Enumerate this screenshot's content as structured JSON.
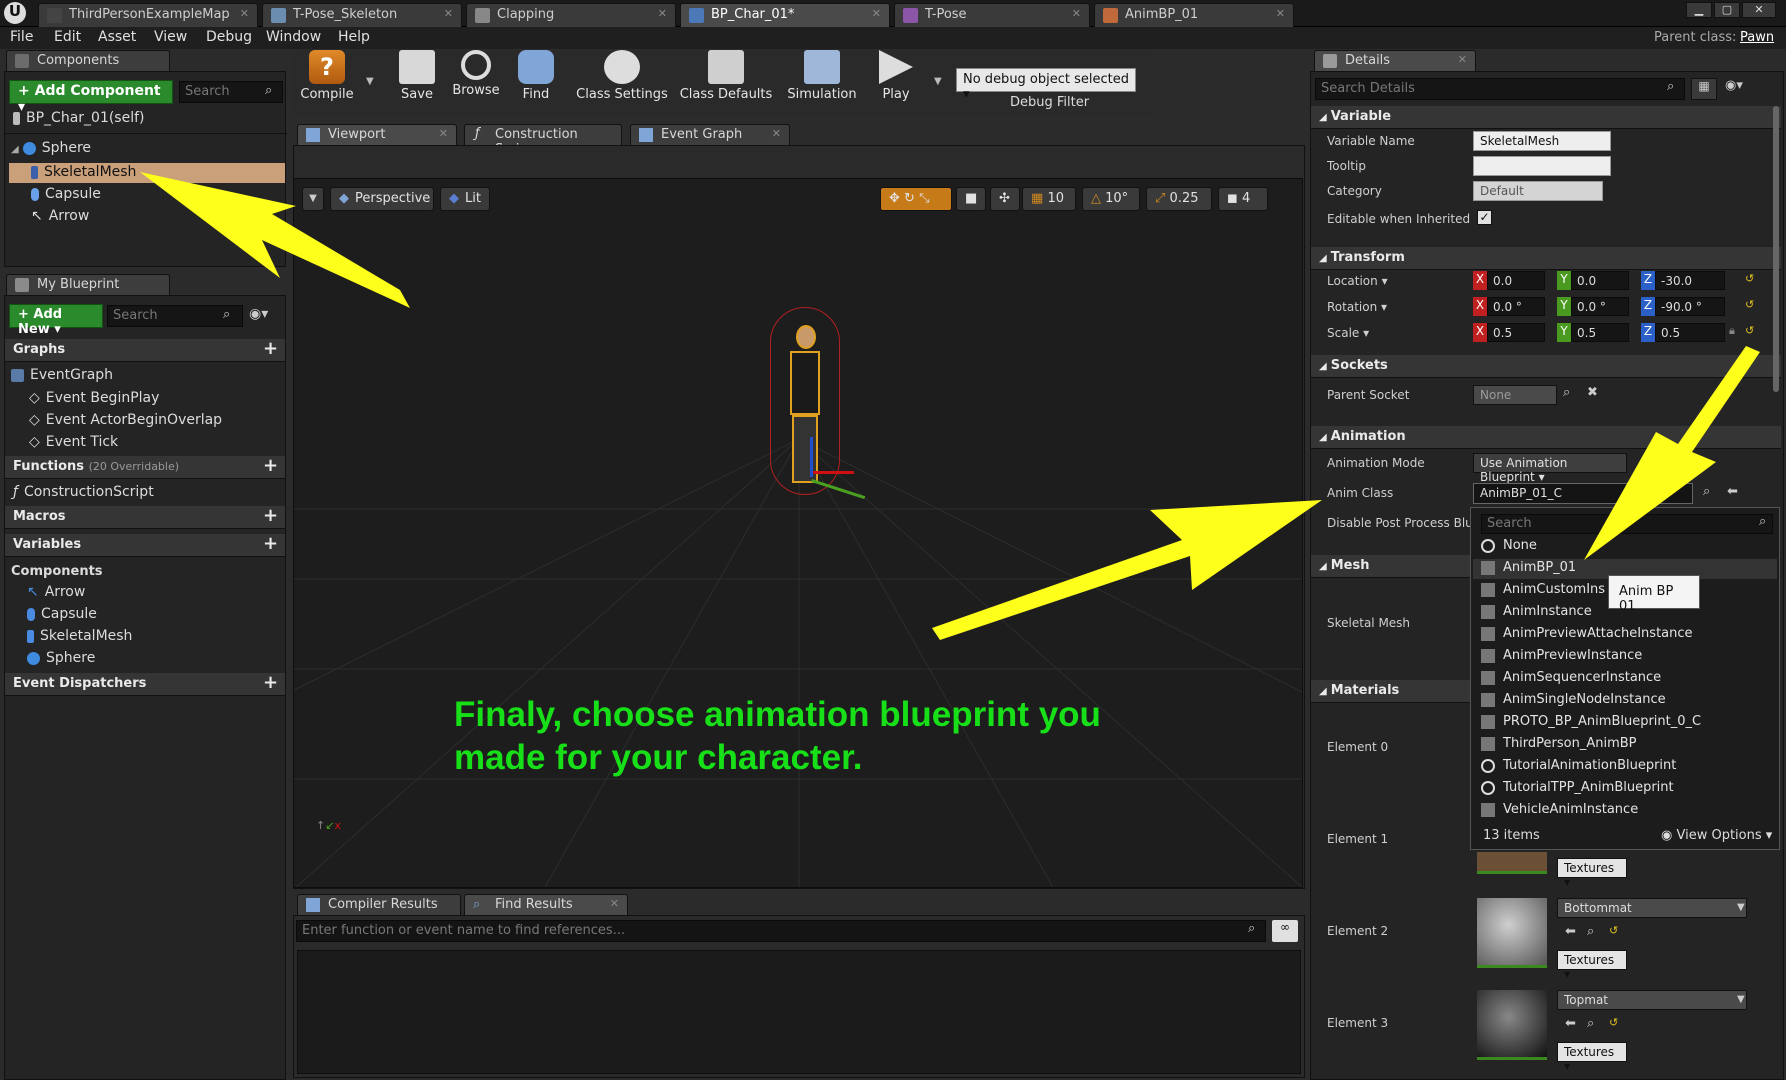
{
  "tabs": [
    "ThirdPersonExampleMap",
    "T-Pose_Skeleton",
    "Clapping",
    "BP_Char_01*",
    "T-Pose",
    "AnimBP_01"
  ],
  "menu": [
    "File",
    "Edit",
    "Asset",
    "View",
    "Debug",
    "Window",
    "Help"
  ],
  "parent_class_label": "Parent class:",
  "parent_class_value": "Pawn",
  "components_panel": {
    "tab": "Components",
    "add_button": "+ Add Component ▾",
    "search_placeholder": "Search",
    "self": "BP_Char_01(self)",
    "tree": [
      "Sphere",
      "SkeletalMesh",
      "Capsule",
      "Arrow"
    ]
  },
  "myblueprint_panel": {
    "tab": "My Blueprint",
    "add_button": "+ Add New ▾",
    "search_placeholder": "Search",
    "graphs_header": "Graphs",
    "event_graph": "EventGraph",
    "events": [
      "Event BeginPlay",
      "Event ActorBeginOverlap",
      "Event Tick"
    ],
    "functions_header": "Functions",
    "functions_count": "(20 Overridable)",
    "functions": [
      "ConstructionScript"
    ],
    "macros_header": "Macros",
    "variables_header": "Variables",
    "components_header": "Components",
    "var_components": [
      "Arrow",
      "Capsule",
      "SkeletalMesh",
      "Sphere"
    ],
    "dispatchers_header": "Event Dispatchers"
  },
  "toolbar": {
    "compile": "Compile",
    "save": "Save",
    "browse": "Browse",
    "find": "Find",
    "class_settings": "Class Settings",
    "class_defaults": "Class Defaults",
    "simulation": "Simulation",
    "play": "Play",
    "debug_select": "No debug object selected ▾",
    "debug_filter": "Debug Filter"
  },
  "editor_tabs": [
    "Viewport",
    "Construction Scrip",
    "Event Graph"
  ],
  "viewport": {
    "perspective": "Perspective",
    "lit": "Lit",
    "grid_snap": "10",
    "rot_snap": "10°",
    "scale_snap": "0.25",
    "cam_speed": "4",
    "annotation": "Finaly, choose animation blueprint you made for your character."
  },
  "bottom_tabs": [
    "Compiler Results",
    "Find Results"
  ],
  "find_placeholder": "Enter function or event name to find references...",
  "details": {
    "tab": "Details",
    "search_placeholder": "Search Details",
    "variable_header": "Variable",
    "variable_name_label": "Variable Name",
    "variable_name_value": "SkeletalMesh",
    "tooltip_label": "Tooltip",
    "category_label": "Category",
    "category_value": "Default",
    "editable_label": "Editable when Inherited",
    "transform_header": "Transform",
    "location_label": "Location ▾",
    "rotation_label": "Rotation ▾",
    "scale_label": "Scale ▾",
    "location": [
      "0.0",
      "0.0",
      "-30.0"
    ],
    "rotation": [
      "0.0 °",
      "0.0 °",
      "-90.0 °"
    ],
    "scale": [
      "0.5",
      "0.5",
      "0.5"
    ],
    "axis": [
      "X",
      "Y",
      "Z"
    ],
    "sockets_header": "Sockets",
    "parent_socket_label": "Parent Socket",
    "parent_socket_value": "None",
    "animation_header": "Animation",
    "anim_mode_label": "Animation Mode",
    "anim_mode_value": "Use Animation Blueprint ▾",
    "anim_class_label": "Anim Class",
    "anim_class_value": "AnimBP_01_C",
    "disable_pp_label": "Disable Post Process Blu",
    "mesh_header": "Mesh",
    "skeletal_mesh_label": "Skeletal Mesh",
    "materials_header": "Materials",
    "elements": [
      "Element 0",
      "Element 1",
      "Element 2",
      "Element 3"
    ],
    "element2_mat": "Bottommat",
    "element3_mat": "Topmat",
    "textures": "Textures ▾"
  },
  "anim_dropdown": {
    "search_placeholder": "Search",
    "items": [
      "None",
      "AnimBP_01",
      "AnimCustomIns",
      "AnimInstance",
      "AnimPreviewAttacheInstance",
      "AnimPreviewInstance",
      "AnimSequencerInstance",
      "AnimSingleNodeInstance",
      "PROTO_BP_AnimBlueprint_0_C",
      "ThirdPerson_AnimBP",
      "TutorialAnimationBlueprint",
      "TutorialTPP_AnimBlueprint",
      "VehicleAnimInstance"
    ],
    "count": "13 items",
    "view_options": "View Options ▾",
    "tooltip": "Anim BP 01"
  },
  "colors": {
    "annotation_green": "#18e018",
    "arrow_yellow": "#ffff1c",
    "add_green": "#2b8a2b",
    "selected_row": "#c9a07a"
  }
}
